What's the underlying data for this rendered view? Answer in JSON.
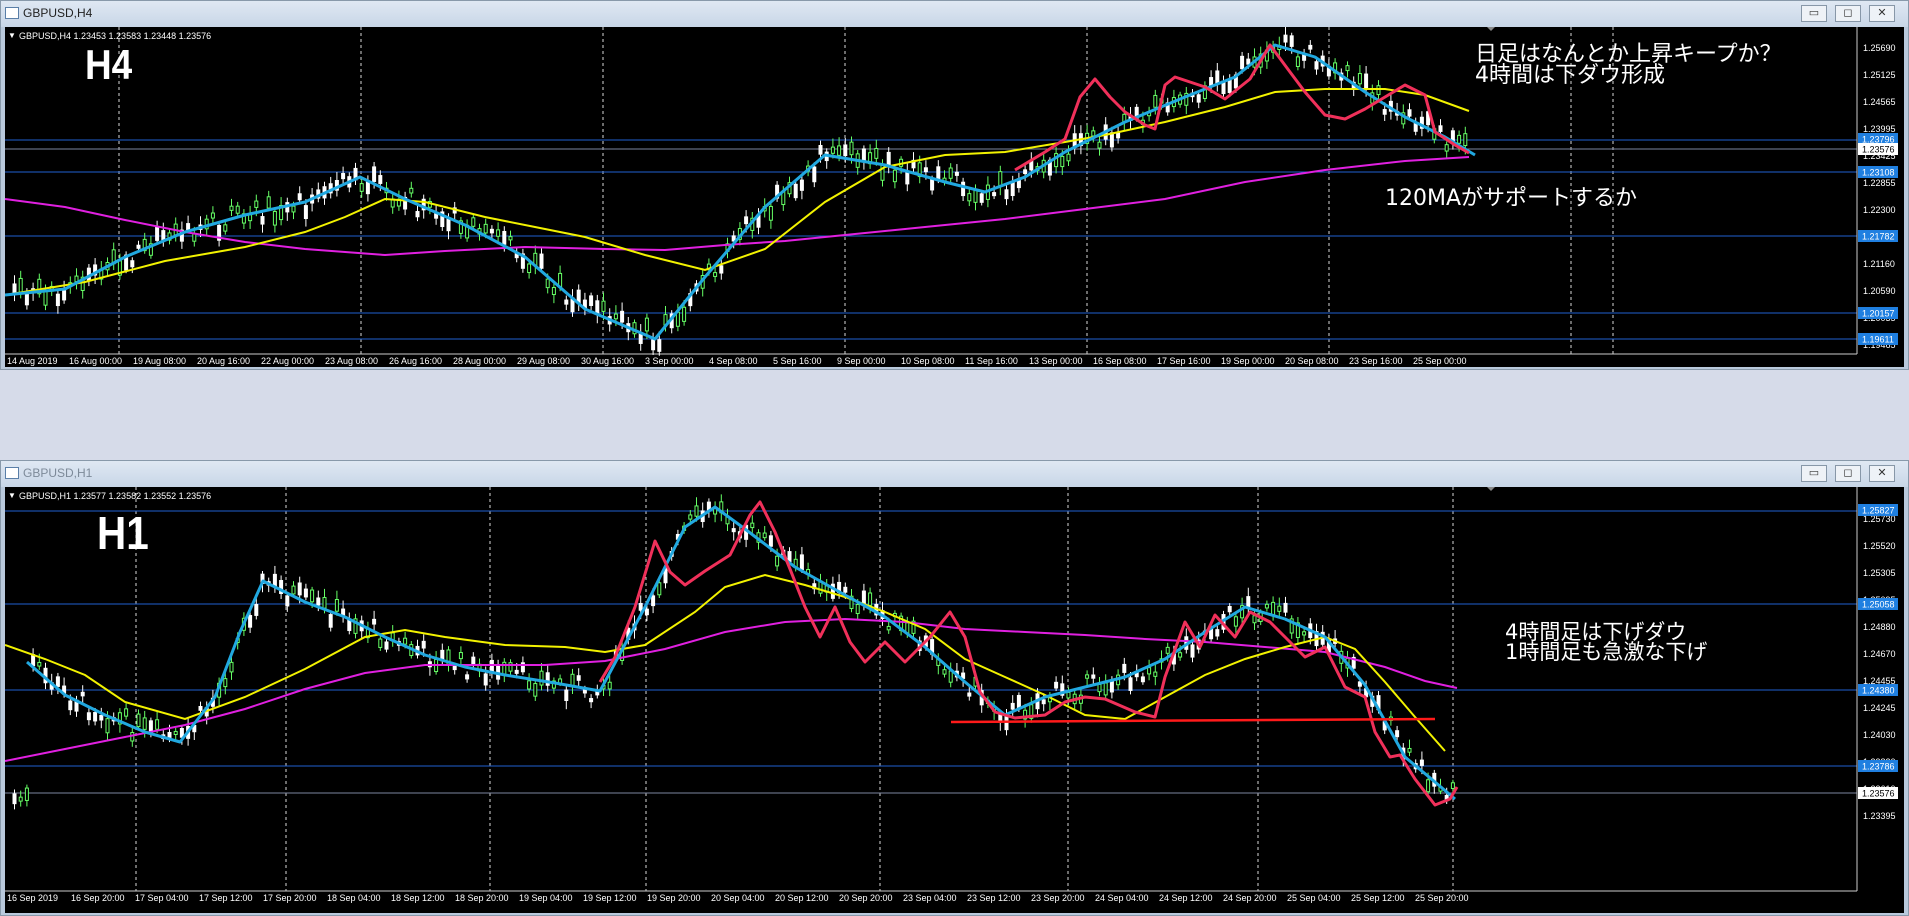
{
  "windows": [
    {
      "title": "GBPUSD,H4",
      "info": "GBPUSD,H4  1.23453 1.23583 1.23448 1.23576",
      "label": "H4",
      "annotations": [
        "日足はなんとか上昇キープか？",
        "4時間は下ダウ形成",
        "120MAがサポートするか"
      ],
      "price_ticks": [
        "1.25690",
        "1.25125",
        "1.24565",
        "1.23995",
        "1.23425",
        "1.22855",
        "1.22300",
        "1.21730",
        "1.21160",
        "1.20590",
        "1.20035",
        "1.19465"
      ],
      "price_tags": [
        "1.23796",
        "1.23576",
        "1.23108",
        "1.21782",
        "1.20157",
        "1.19611"
      ],
      "time_labels": [
        "14 Aug 2019",
        "16 Aug 00:00",
        "19 Aug 08:00",
        "20 Aug 16:00",
        "22 Aug 00:00",
        "23 Aug 08:00",
        "26 Aug 16:00",
        "28 Aug 00:00",
        "29 Aug 08:00",
        "30 Aug 16:00",
        "3 Sep 00:00",
        "4 Sep 08:00",
        "5 Sep 16:00",
        "9 Sep 00:00",
        "10 Sep 08:00",
        "11 Sep 16:00",
        "13 Sep 00:00",
        "16 Sep 08:00",
        "17 Sep 16:00",
        "19 Sep 00:00",
        "20 Sep 08:00",
        "23 Sep 16:00",
        "25 Sep 00:00"
      ]
    },
    {
      "title": "GBPUSD,H1",
      "info": "GBPUSD,H1  1.23577 1.23582 1.23552 1.23576",
      "label": "H1",
      "annotations": [
        "4時間足は下げダウ",
        "1時間足も急激な下げ"
      ],
      "price_ticks": [
        "1.25730",
        "1.25520",
        "1.25305",
        "1.25095",
        "1.24880",
        "1.24670",
        "1.24455",
        "1.24245",
        "1.24030",
        "1.23820",
        "1.23610",
        "1.23395"
      ],
      "price_tags": [
        "1.25827",
        "1.25058",
        "1.24380",
        "1.23786",
        "1.23576"
      ],
      "time_labels": [
        "16 Sep 2019",
        "16 Sep 20:00",
        "17 Sep 04:00",
        "17 Sep 12:00",
        "17 Sep 20:00",
        "18 Sep 04:00",
        "18 Sep 12:00",
        "18 Sep 20:00",
        "19 Sep 04:00",
        "19 Sep 12:00",
        "19 Sep 20:00",
        "20 Sep 04:00",
        "20 Sep 12:00",
        "20 Sep 20:00",
        "23 Sep 04:00",
        "23 Sep 12:00",
        "23 Sep 20:00",
        "24 Sep 04:00",
        "24 Sep 12:00",
        "24 Sep 20:00",
        "25 Sep 04:00",
        "25 Sep 12:00",
        "25 Sep 20:00"
      ]
    }
  ],
  "colors": {
    "blue_line": "#21a8e0",
    "yellow_ma": "#f2f200",
    "magenta_ma": "#e020e0",
    "red_line": "#f0305a",
    "support": "#ff1a1a",
    "bull": "#66ff66",
    "bear": "#ffffff",
    "hline": "#1f5fd0",
    "tag": "#1f7fe0"
  }
}
